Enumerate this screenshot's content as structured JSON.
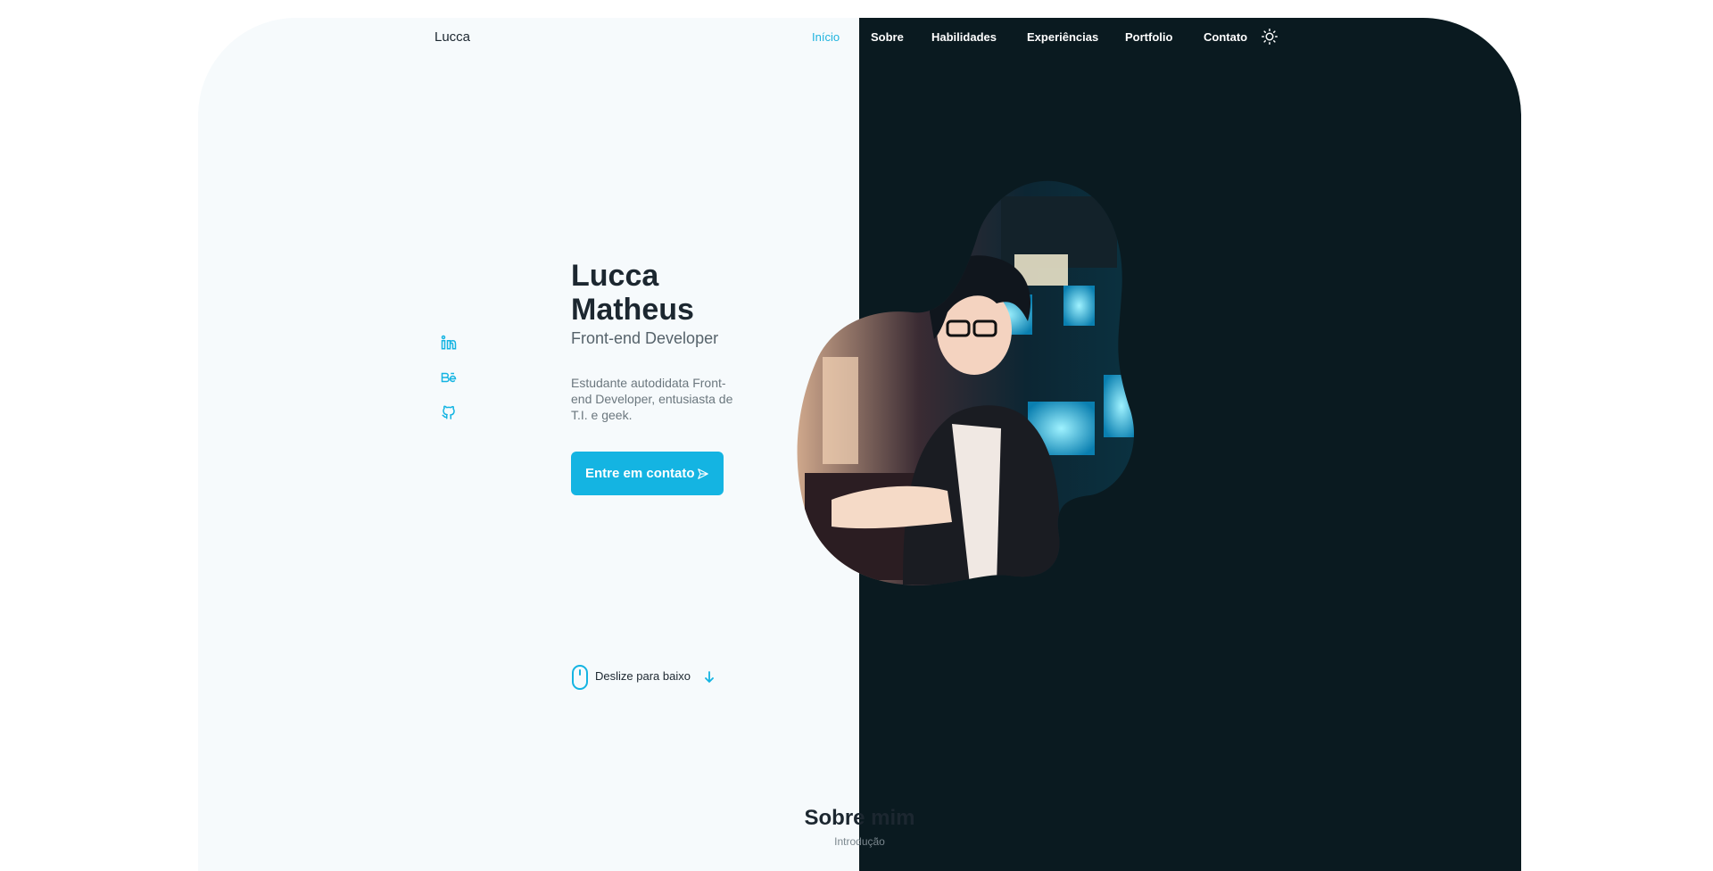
{
  "header": {
    "logo": "Lucca",
    "nav": [
      "Início",
      "Sobre",
      "Habilidades",
      "Experiências",
      "Portfolio",
      "Contato"
    ],
    "theme_toggle_icon": "sun-icon"
  },
  "social": [
    "linkedin-icon",
    "behance-icon",
    "github-icon"
  ],
  "hero": {
    "name": "Lucca Matheus",
    "subtitle": "Front-end Developer",
    "description": "Estudante autodidata Front-end Developer, entusiasta de T.I. e geek.",
    "cta_label": "Entre em contato",
    "cta_icon": "send-icon"
  },
  "scroll": {
    "label": "Deslize para baixo",
    "icon": "mouse-icon"
  },
  "about": {
    "title": "Sobre mim",
    "subtitle": "Introdução"
  },
  "colors": {
    "accent": "#14b4e2",
    "dark": "#0a1a20",
    "light": "#f6fafc",
    "text": "#1c2730"
  }
}
